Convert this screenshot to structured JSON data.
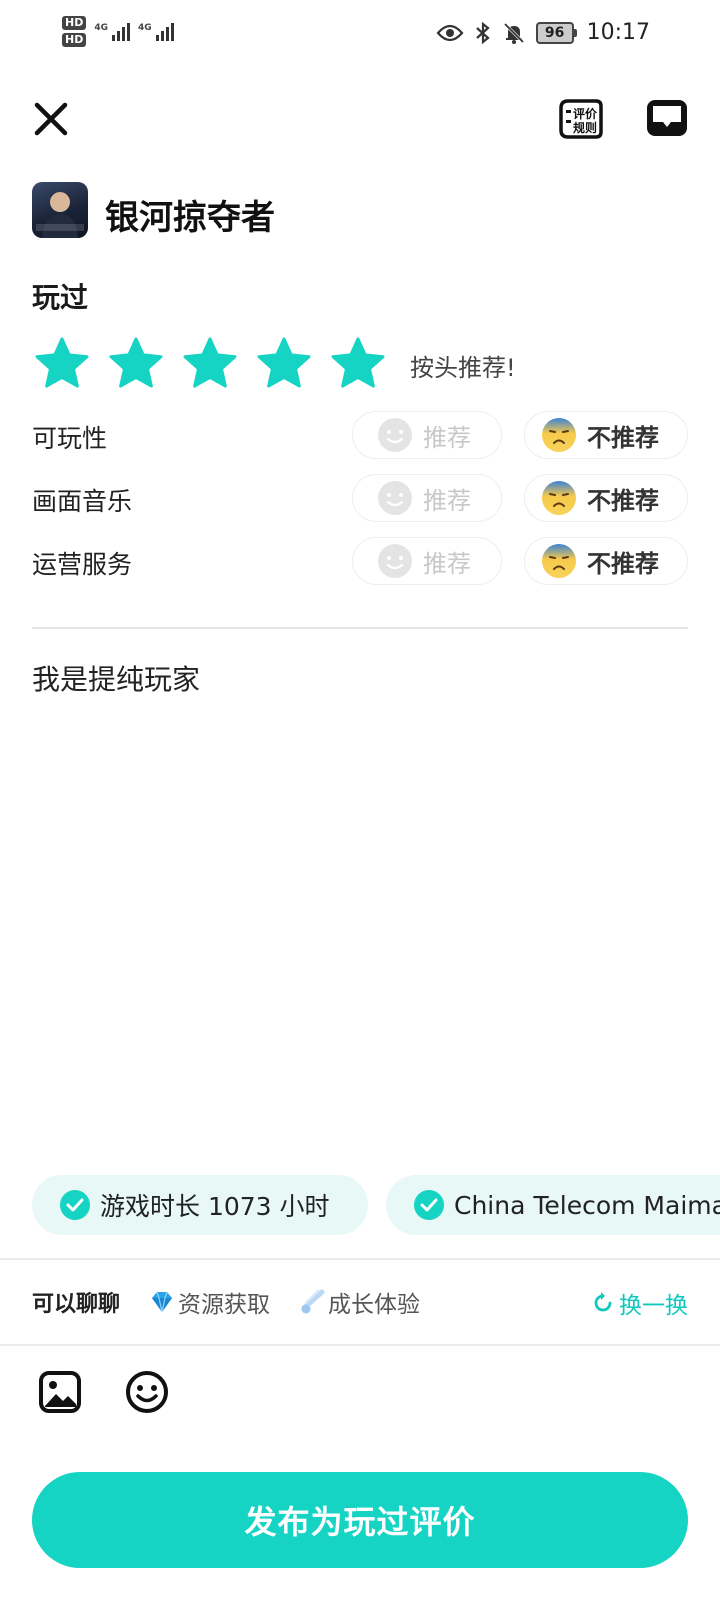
{
  "status_bar": {
    "hd1": "HD",
    "hd2": "HD",
    "net1": "4G",
    "net2": "4G",
    "battery": "96",
    "time": "10:17"
  },
  "header": {
    "rules_label_line1": "评价",
    "rules_label_line2": "规则"
  },
  "game": {
    "title": "银河掠夺者",
    "icon": "game-cover-image"
  },
  "review": {
    "status_label": "玩过",
    "rating": 5,
    "rating_max": 5,
    "rating_text": "按头推荐!",
    "accent_color": "#16d4c4",
    "aspects": [
      {
        "label": "可玩性",
        "recommend_label": "推荐",
        "not_recommend_label": "不推荐",
        "selected": "not_recommend"
      },
      {
        "label": "画面音乐",
        "recommend_label": "推荐",
        "not_recommend_label": "不推荐",
        "selected": "not_recommend"
      },
      {
        "label": "运营服务",
        "recommend_label": "推荐",
        "not_recommend_label": "不推荐",
        "selected": "not_recommend"
      }
    ],
    "content": "我是提纯玩家"
  },
  "tags": [
    {
      "label": "游戏时长 1073 小时",
      "checked": true
    },
    {
      "label": "China Telecom Maima",
      "checked": true
    }
  ],
  "prompts": {
    "label": "可以聊聊",
    "items": [
      {
        "icon": "diamond-icon",
        "label": "资源获取"
      },
      {
        "icon": "comet-icon",
        "label": "成长体验"
      }
    ],
    "refresh_label": "换一换"
  },
  "publish_label": "发布为玩过评价"
}
